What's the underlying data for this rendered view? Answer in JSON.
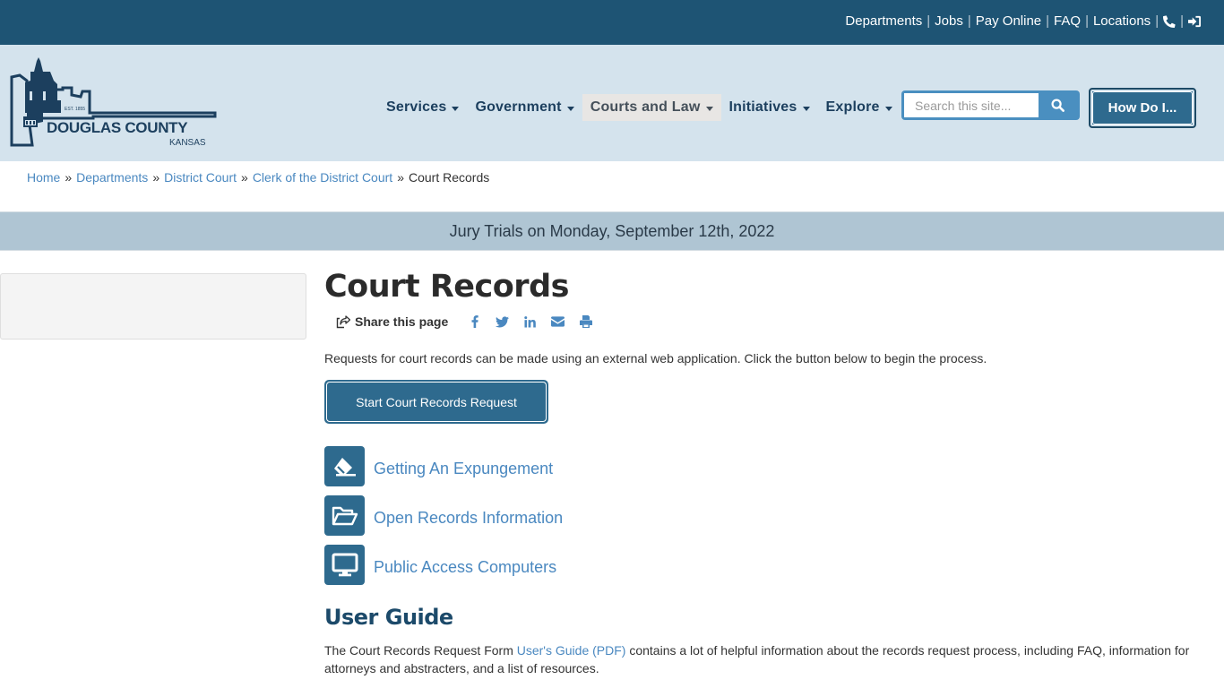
{
  "topbar": {
    "links": [
      "Departments",
      "Jobs",
      "Pay Online",
      "FAQ",
      "Locations"
    ],
    "icons": [
      "phone-icon",
      "sign-in-icon"
    ]
  },
  "logo": {
    "name": "DOUGLAS COUNTY",
    "state": "KANSAS",
    "established": "EST. 1855"
  },
  "nav": {
    "items": [
      {
        "label": "Services",
        "active": false
      },
      {
        "label": "Government",
        "active": false
      },
      {
        "label": "Courts and Law",
        "active": true
      },
      {
        "label": "Initiatives",
        "active": false
      },
      {
        "label": "Explore",
        "active": false
      }
    ]
  },
  "search": {
    "placeholder": "Search this site...",
    "value": ""
  },
  "howdoi": {
    "label": "How Do I..."
  },
  "breadcrumb": {
    "items": [
      "Home",
      "Departments",
      "District Court",
      "Clerk of the District Court"
    ],
    "current": "Court Records"
  },
  "banner": {
    "text": "Jury Trials on Monday, September 12th, 2022"
  },
  "page": {
    "title": "Court Records",
    "share_label": "Share this page",
    "share_icons": [
      "facebook-icon",
      "twitter-icon",
      "linkedin-icon",
      "email-icon",
      "print-icon"
    ],
    "intro": "Requests for court records can be made using an external web application. Click the button below to begin the process.",
    "start_button": "Start Court Records Request",
    "links": [
      {
        "label": "Getting An Expungement",
        "icon": "eraser-icon"
      },
      {
        "label": "Open Records Information",
        "icon": "folder-open-icon"
      },
      {
        "label": "Public Access Computers",
        "icon": "desktop-icon"
      }
    ],
    "user_guide": {
      "title": "User Guide",
      "text_before": "The Court Records Request Form ",
      "link": "User's Guide (PDF)",
      "text_after": " contains a lot of helpful information about the records request process, including FAQ, information for attorneys and abstracters, and a list of resources."
    }
  },
  "colors": {
    "topbar": "#1e5474",
    "header": "#d4e3ed",
    "primary_button": "#2e6a8e",
    "link": "#4a88c0",
    "banner": "#afc5d3"
  }
}
